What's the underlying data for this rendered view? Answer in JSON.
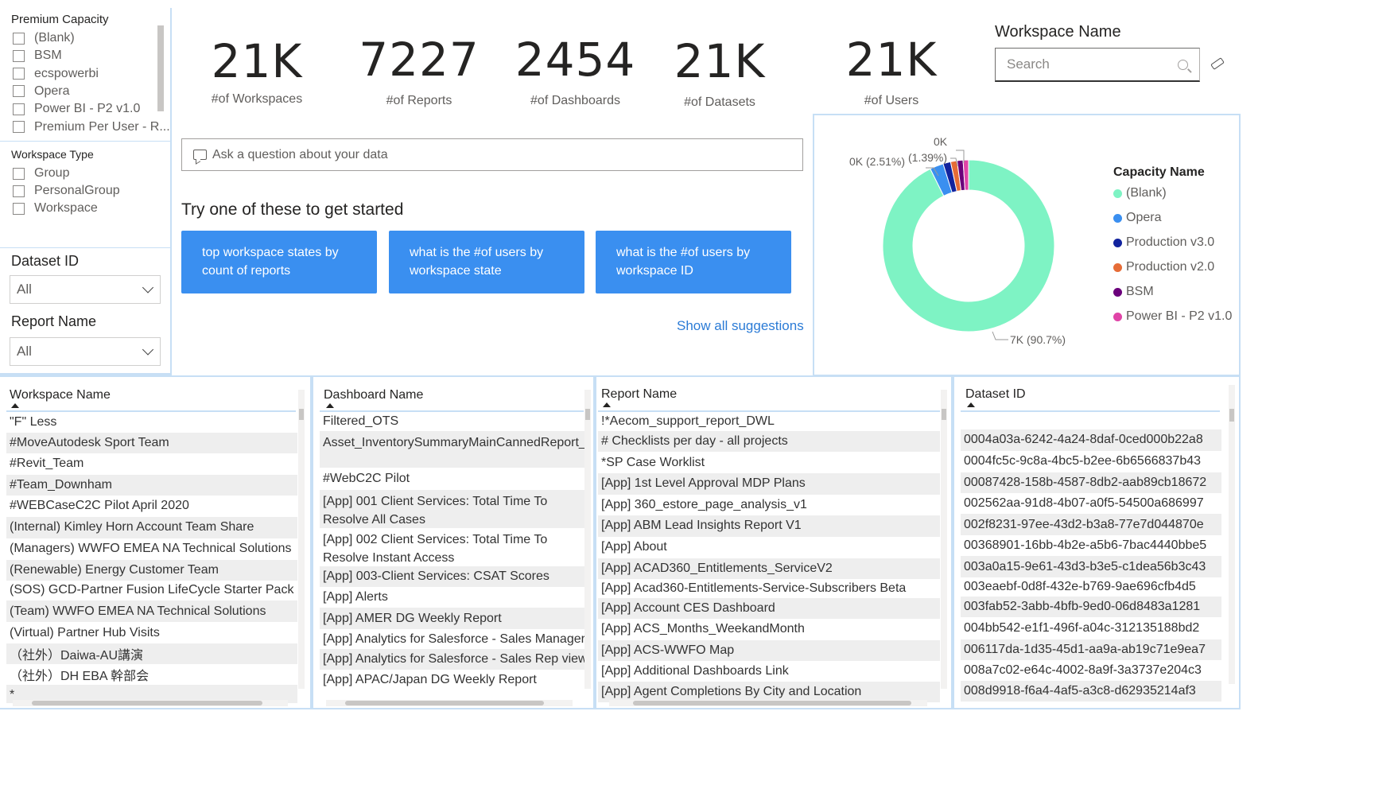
{
  "slicers": {
    "premium_capacity": {
      "title": "Premium Capacity",
      "items": [
        "(Blank)",
        "BSM",
        "ecspowerbi",
        "Opera",
        "Power BI - P2 v1.0",
        "Premium Per User - R..."
      ]
    },
    "workspace_type": {
      "title": "Workspace Type",
      "items": [
        "Group",
        "PersonalGroup",
        "Workspace"
      ]
    },
    "dataset_id": {
      "title": "Dataset ID",
      "value": "All"
    },
    "report_name": {
      "title": "Report Name",
      "value": "All"
    }
  },
  "kpis": [
    {
      "value": "21K",
      "label": "#of Workspaces"
    },
    {
      "value": "7227",
      "label": "#of Reports"
    },
    {
      "value": "2454",
      "label": "#of Dashboards"
    },
    {
      "value": "21K",
      "label": "#of Datasets"
    },
    {
      "value": "21K",
      "label": "#of Users"
    }
  ],
  "workspace_search": {
    "title": "Workspace Name",
    "placeholder": "Search"
  },
  "qa": {
    "placeholder": "Ask a question about your data",
    "prompt": "Try one of these to get started",
    "suggestions": [
      "top workspace states by count of reports",
      "what is the #of users by workspace state",
      "what is the #of users by workspace ID"
    ],
    "show_all": "Show all suggestions"
  },
  "donut": {
    "legend_title": "Capacity Name",
    "legend": [
      {
        "name": "(Blank)",
        "color": "#7ef3c4"
      },
      {
        "name": "Opera",
        "color": "#3a8ff0"
      },
      {
        "name": "Production v3.0",
        "color": "#12239e"
      },
      {
        "name": "Production v2.0",
        "color": "#e66c37"
      },
      {
        "name": "BSM",
        "color": "#6b007b"
      },
      {
        "name": "Power BI - P2 v1.0",
        "color": "#e044a7"
      }
    ],
    "labels": {
      "top": "0K",
      "left": "0K (2.51%)",
      "mid": "(1.39%)",
      "bottom": "7K (90.7%)"
    }
  },
  "chart_data": {
    "type": "pie",
    "categories": [
      "(Blank)",
      "Opera",
      "Production v3.0",
      "Production v2.0",
      "BSM",
      "Power BI - P2 v1.0"
    ],
    "values": [
      90.7,
      2.51,
      1.39,
      1.2,
      1.1,
      1.0
    ],
    "title": "",
    "legend_title": "Capacity Name",
    "legend_position": "right"
  },
  "tables": {
    "workspace": {
      "header": "Workspace Name",
      "rows": [
        "\"F\" Less",
        "#MoveAutodesk Sport Team",
        "#Revit_Team",
        "#Team_Downham",
        "#WEBCaseC2C Pilot April 2020",
        "(Internal) Kimley Horn Account Team Share",
        "(Managers) WWFO EMEA NA Technical Solutions",
        "(Renewable) Energy Customer Team",
        "(SOS) GCD-Partner Fusion LifeCycle Starter Pack",
        "(Team) WWFO EMEA NA Technical Solutions",
        "(Virtual) Partner Hub Visits",
        "（社外）Daiwa-AU講演",
        "（社外）DH EBA 幹部会",
        "*"
      ]
    },
    "dashboard": {
      "header": "Dashboard Name",
      "rows": [
        "Filtered_OTS",
        "Asset_InventorySummaryMainCannedReport_JAN.xlsx",
        "#WebC2C Pilot",
        "[App] 001 Client Services: Total Time To Resolve All Cases",
        "[App] 002 Client Services: Total Time To Resolve Instant Access",
        "[App] 003-Client Services: CSAT Scores",
        "[App] Alerts",
        "[App] AMER DG Weekly Report",
        "[App] Analytics for Salesforce - Sales Manager",
        "[App] Analytics for Salesforce - Sales Rep view",
        "[App] APAC/Japan DG Weekly Report"
      ]
    },
    "report": {
      "header": "Report Name",
      "rows": [
        "!*Aecom_support_report_DWL",
        "# Checklists per day - all projects",
        "*SP Case Worklist",
        "[App] 1st Level Approval MDP Plans",
        "[App] 360_estore_page_analysis_v1",
        "[App] ABM Lead Insights Report V1",
        "[App] About",
        "[App] ACAD360_Entitlements_ServiceV2",
        "[App] Acad360-Entitlements-Service-Subscribers Beta",
        "[App] Account CES Dashboard",
        "[App] ACS_Months_WeekandMonth",
        "[App] ACS-WWFO Map",
        "[App] Additional Dashboards Link",
        "[App] Agent Completions By City and Location"
      ]
    },
    "dataset": {
      "header": "Dataset ID",
      "rows": [
        "",
        "0004a03a-6242-4a24-8daf-0ced000b22a8",
        "0004fc5c-9c8a-4bc5-b2ee-6b6566837b43",
        "00087428-158b-4587-8db2-aab89cb18672",
        "002562aa-91d8-4b07-a0f5-54500a686997",
        "002f8231-97ee-43d2-b3a8-77e7d044870e",
        "00368901-16bb-4b2e-a5b6-7bac4440bbe5",
        "003a0a15-9e61-43d3-b3e5-c1dea56b3c43",
        "003eaebf-0d8f-432e-b769-9ae696cfb4d5",
        "003fab52-3abb-4bfb-9ed0-06d8483a1281",
        "004bb542-e1f1-496f-a04c-312135188bd2",
        "006117da-1d35-45d1-aa9a-ab19c71e9ea7",
        "008a7c02-e64c-4002-8a9f-3a3737e204c3",
        "008d9918-f6a4-4af5-a3c8-d62935214af3"
      ]
    }
  }
}
